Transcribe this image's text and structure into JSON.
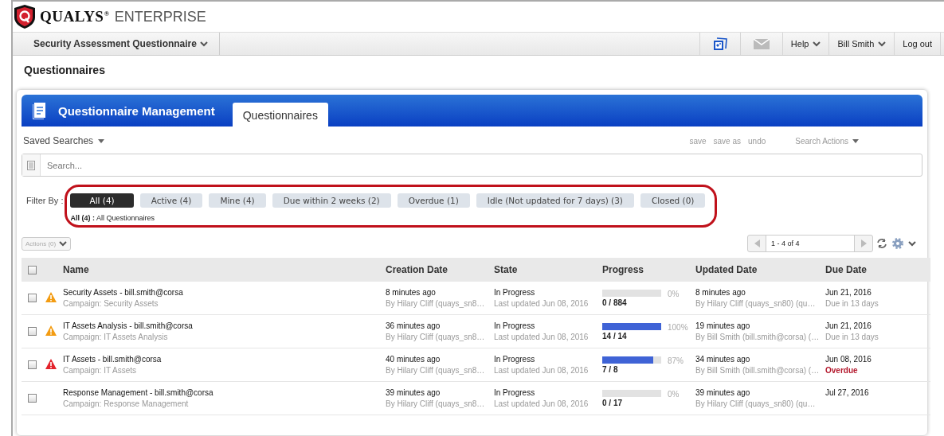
{
  "brand": {
    "name": "QUALYS$^{®}$",
    "product": "ENTERPRISE"
  },
  "nav": {
    "module": "Security Assessment Questionnaire",
    "help": "Help",
    "user": "Bill Smith",
    "logout": "Log out"
  },
  "page_title": "Questionnaires",
  "panel": {
    "title": "Questionnaire Management",
    "tabs": [
      {
        "label": "Questionnaires",
        "selected": true
      }
    ]
  },
  "saved_searches": "Saved Searches",
  "search_links": [
    "save",
    "save as",
    "undo"
  ],
  "search_actions": "Search Actions",
  "search": {
    "placeholder": "Search..."
  },
  "filter_label": "Filter By :",
  "filters": [
    {
      "label": "All (4)",
      "selected": true
    },
    {
      "label": "Active (4)",
      "selected": false
    },
    {
      "label": "Mine (4)",
      "selected": false
    },
    {
      "label": "Due within 2 weeks (2)",
      "selected": false
    },
    {
      "label": "Overdue (1)",
      "selected": false
    },
    {
      "label": "Idle (Not updated for 7 days) (3)",
      "selected": false
    },
    {
      "label": "Closed (0)",
      "selected": false
    }
  ],
  "filter_summary": "**All (4) :** All Questionnaires",
  "actions": "Actions (0)",
  "pager": "1 - 4 of 4",
  "table": {
    "select_all": {
      "checked": false
    },
    "columns": [
      "Name",
      "Creation Date",
      "State",
      "Progress",
      "Updated Date",
      "Due Date"
    ],
    "rows": [
      {
        "checked": false,
        "kind": "warning",
        "name": "Security Assets - bill.smith@corsa",
        "campaign": "Campaign: Security Assets",
        "created": "8 minutes ago",
        "created_by": "By Hilary Cliff (quays_sn8…",
        "state": "In Progress",
        "state_note": "Last updated Jun 08, 2016",
        "level": 0,
        "percent": "0%",
        "count": "0 / 884",
        "updated": "8 minutes ago",
        "updated_by": "By Hilary Cliff (quays_sn80) (qu…",
        "due": "Jun 21, 2016",
        "due_note": "Due in 13 days",
        "overdue": false
      },
      {
        "checked": false,
        "kind": "warning",
        "name": "IT Assets Analysis - bill.smith@corsa",
        "campaign": "Campaign: IT Assets Analysis",
        "created": "36 minutes ago",
        "created_by": "By Hilary Cliff (quays_sn8…",
        "state": "In Progress",
        "state_note": "Last updated Jun 08, 2016",
        "level": 1,
        "percent": "100%",
        "count": "14 / 14",
        "updated": "19 minutes ago",
        "updated_by": "By Bill Smith (bill.smith@corsa) (…",
        "due": "Jun 21, 2016",
        "due_note": "Due in 13 days",
        "overdue": false
      },
      {
        "checked": false,
        "kind": "error",
        "name": "IT Assets - bill.smith@corsa",
        "campaign": "Campaign: IT Assets",
        "created": "40 minutes ago",
        "created_by": "By Hilary Cliff (quays_sn8…",
        "state": "In Progress",
        "state_note": "Last updated Jun 08, 2016",
        "level": 0.87,
        "percent": "87%",
        "count": "7 / 8",
        "updated": "34 minutes ago",
        "updated_by": "By Bill Smith (bill.smith@corsa) (…",
        "due": "Jun 08, 2016",
        "due_note": "Overdue",
        "overdue": true
      },
      {
        "checked": false,
        "kind": "plain",
        "name": "Response Management - bill.smith@corsa",
        "campaign": "Campaign: Response Management",
        "created": "39 minutes ago",
        "created_by": "By Hilary Cliff (quays_sn8…",
        "state": "In Progress",
        "state_note": "Last updated Jun 08, 2016",
        "level": 0,
        "percent": "0%",
        "count": "0 / 17",
        "updated": "39 minutes ago",
        "updated_by": "By Hilary Cliff (quays_sn80) (qu…",
        "due": "Jul 27, 2016"
      }
    ]
  }
}
